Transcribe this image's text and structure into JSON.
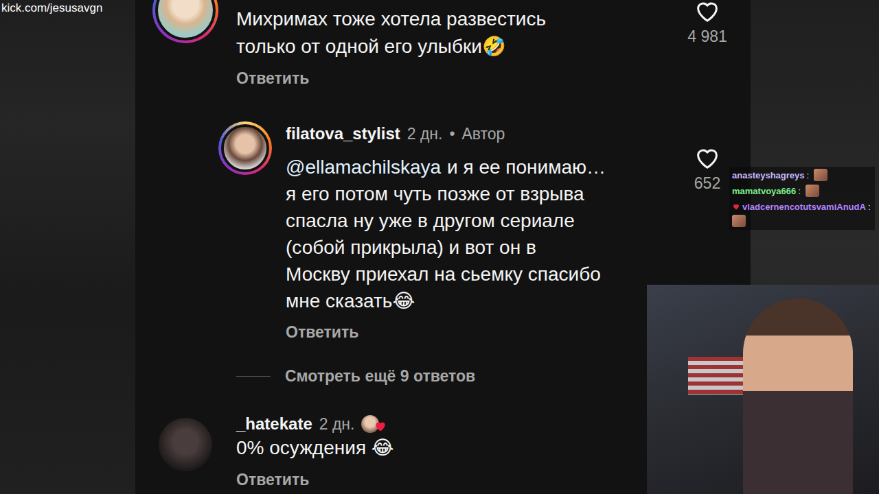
{
  "stream": {
    "url": "kick.com/jesusavgn"
  },
  "comments": [
    {
      "lines": [
        "Михримах тоже хотела развестись",
        "только от одной его улыбки🤣"
      ],
      "likes": "4 981",
      "liked": false,
      "reply_label": "Ответить",
      "replies": [
        {
          "username": "filatova_stylist",
          "time": "2 дн.",
          "separator": "•",
          "role": "Автор",
          "mention": "@ellamachilskaya",
          "lines": [
            "и я ее понимаю…",
            "я его потом чуть позже от взрыва",
            "спасла ну уже в другом сериале",
            "(собой прикрыла) и вот он в",
            "Москву приехал на сьемку спасибо",
            "мне сказать😂"
          ],
          "likes": "652",
          "liked": false,
          "reply_label": "Ответить"
        }
      ],
      "more_replies": "Смотреть ещё 9 ответов"
    },
    {
      "username": "_hatekate",
      "time": "2 дн.",
      "liked_by_author": true,
      "lines": [
        "0% осуждения 😂"
      ],
      "reply_label": "Ответить",
      "replies": []
    }
  ],
  "chat": [
    {
      "user": "anasteyshagreys",
      "sep": ":",
      "color": "#c9b8ff",
      "badge": false
    },
    {
      "user": "mamatvoya666",
      "sep": ":",
      "color": "#7ef08c",
      "badge": false
    },
    {
      "user": "vladcernencotutsvamiAnudA",
      "sep": ":",
      "color": "#b583ff",
      "badge": true
    }
  ]
}
